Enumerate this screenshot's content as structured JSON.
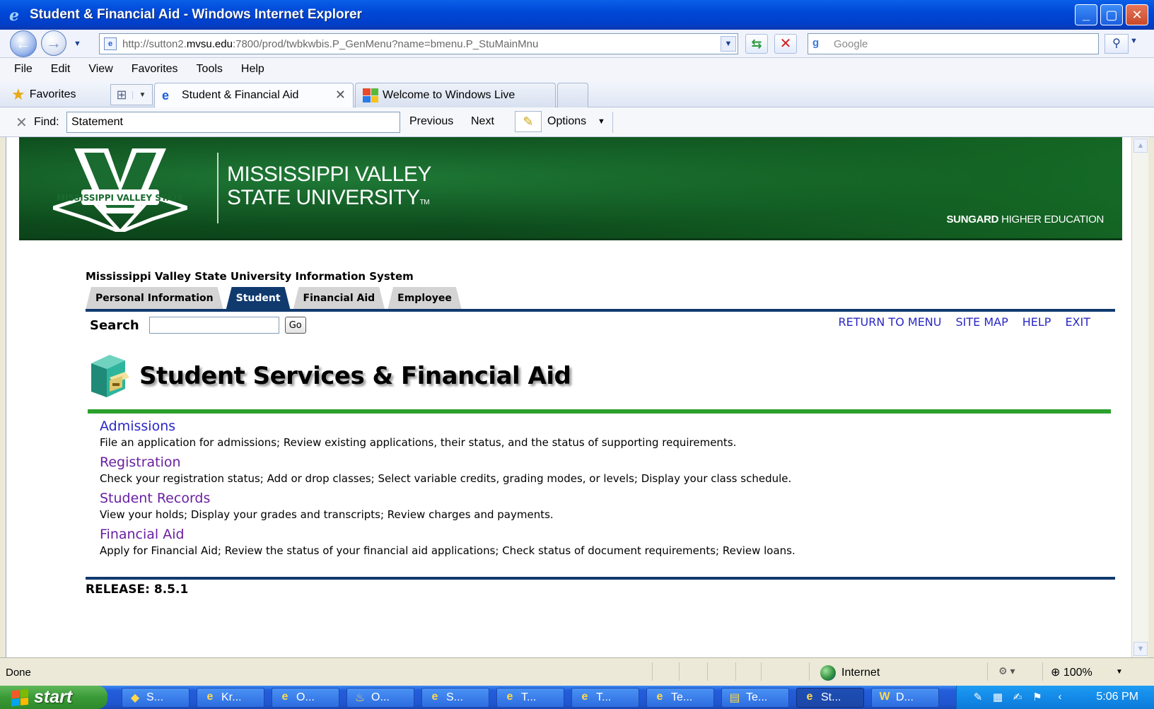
{
  "window": {
    "title": "Student & Financial Aid - Windows Internet Explorer"
  },
  "address": {
    "url_prefix": "http://sutton2.",
    "url_domain": "mvsu.edu",
    "url_suffix": ":7800/prod/twbkwbis.P_GenMenu?name=bmenu.P_StuMainMnu",
    "search_placeholder": "Google"
  },
  "menubar": [
    "File",
    "Edit",
    "View",
    "Favorites",
    "Tools",
    "Help"
  ],
  "tabs": {
    "favorites_label": "Favorites",
    "active_tab": "Student & Financial Aid",
    "inactive_tab": "Welcome to Windows Live"
  },
  "findbar": {
    "label": "Find:",
    "value": "Statement",
    "previous": "Previous",
    "next": "Next",
    "options": "Options"
  },
  "banner": {
    "line1": "MISSISSIPPI VALLEY",
    "line2": "STATE UNIVERSITY",
    "tm": "TM",
    "vendor_bold": "SUNGARD",
    "vendor_rest": " HIGHER EDUCATION"
  },
  "page": {
    "system_name": "Mississippi Valley State University Information System",
    "nav_tabs": [
      "Personal Information",
      "Student",
      "Financial Aid",
      "Employee"
    ],
    "search_label": "Search",
    "go_button": "Go",
    "top_links": [
      "RETURN TO MENU",
      "SITE MAP",
      "HELP",
      "EXIT"
    ],
    "title": "Student Services & Financial Aid",
    "menu": [
      {
        "title": "Admissions",
        "desc": "File an application for admissions; Review existing applications, their status, and the status of supporting requirements."
      },
      {
        "title": "Registration",
        "desc": "Check your registration status; Add or drop classes; Select variable credits, grading modes, or levels; Display your class schedule."
      },
      {
        "title": "Student Records",
        "desc": "View your holds; Display your grades and transcripts; Review charges and payments."
      },
      {
        "title": "Financial Aid",
        "desc": "Apply for Financial Aid; Review the status of your financial aid applications; Check status of document requirements; Review loans."
      }
    ],
    "release": "RELEASE: 8.5.1"
  },
  "statusbar": {
    "status": "Done",
    "zone": "Internet",
    "zoom": "100%"
  },
  "taskbar": {
    "start": "start",
    "buttons": [
      "S...",
      "Kr...",
      "O...",
      "O...",
      "S...",
      "T...",
      "T...",
      "Te...",
      "Te...",
      "St...",
      "D..."
    ],
    "clock": "5:06 PM"
  },
  "colors": {
    "banner_green": "#0d4a1c",
    "nav_blue": "#103a6e",
    "link_blue": "#2b27c4",
    "visited_purple": "#6a1fa0",
    "separator_green": "#2ca02c"
  }
}
